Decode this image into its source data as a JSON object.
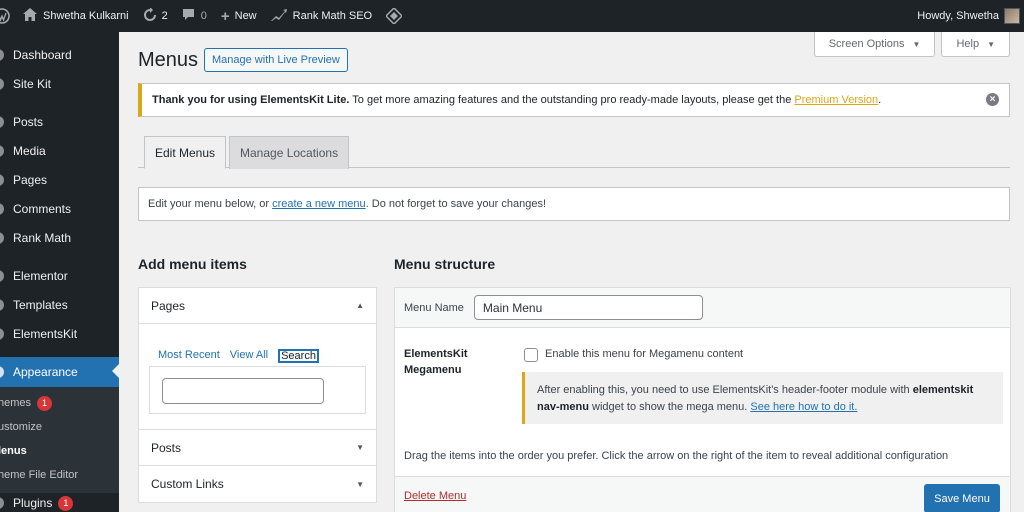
{
  "adminbar": {
    "site_name": "Shwetha Kulkarni",
    "updates_count": "2",
    "comments_count": "0",
    "new_label": "New",
    "seo_label": "Rank Math SEO",
    "howdy": "Howdy, Shwetha"
  },
  "sidebar": {
    "items": [
      {
        "label": "Dashboard"
      },
      {
        "label": "Site Kit"
      },
      {
        "label": "Posts"
      },
      {
        "label": "Media"
      },
      {
        "label": "Pages"
      },
      {
        "label": "Comments"
      },
      {
        "label": "Rank Math"
      },
      {
        "label": "Elementor"
      },
      {
        "label": "Templates"
      },
      {
        "label": "ElementsKit"
      },
      {
        "label": "Appearance"
      }
    ],
    "submenu": [
      {
        "label": "hemes",
        "badge": "1"
      },
      {
        "label": "ustomize"
      },
      {
        "label": "lenus"
      },
      {
        "label": "heme File Editor"
      }
    ],
    "plugins": {
      "label": "Plugins",
      "badge": "1"
    }
  },
  "screen_options": "Screen Options",
  "help": "Help",
  "page": {
    "title": "Menus",
    "live_preview": "Manage with Live Preview"
  },
  "notice": {
    "text_bold": "Thank you for using ElementsKit Lite.",
    "text": "To get more amazing features and the outstanding pro ready-made layouts, please get the",
    "link": "Premium Version",
    "suffix": "."
  },
  "tabs": {
    "edit": "Edit Menus",
    "manage": "Manage Locations"
  },
  "manage_menus": {
    "before": "Edit your menu below, or",
    "link": "create a new menu",
    "after": ". Do not forget to save your changes!"
  },
  "add_items": {
    "heading": "Add menu items",
    "pages": "Pages",
    "tab_recent": "Most Recent",
    "tab_all": "View All",
    "tab_search": "Search",
    "posts": "Posts",
    "custom_links": "Custom Links"
  },
  "structure": {
    "heading": "Menu structure",
    "name_label": "Menu Name",
    "name_value": "Main Menu",
    "mega_label_1": "ElementsKit",
    "mega_label_2": "Megamenu",
    "mega_check_label": "Enable this menu for Megamenu content",
    "info_1": "After enabling this, you need to use ElementsKit's header-footer module with",
    "info_bold": "elementskit",
    "info_bold_2": "nav-menu",
    "info_2": "widget to show the mega menu.",
    "info_link": "See here how to do it.",
    "drag": "Drag the items into the order you prefer. Click the arrow on the right of the item to reveal additional configuration",
    "delete": "Delete Menu",
    "save": "Save Menu"
  }
}
